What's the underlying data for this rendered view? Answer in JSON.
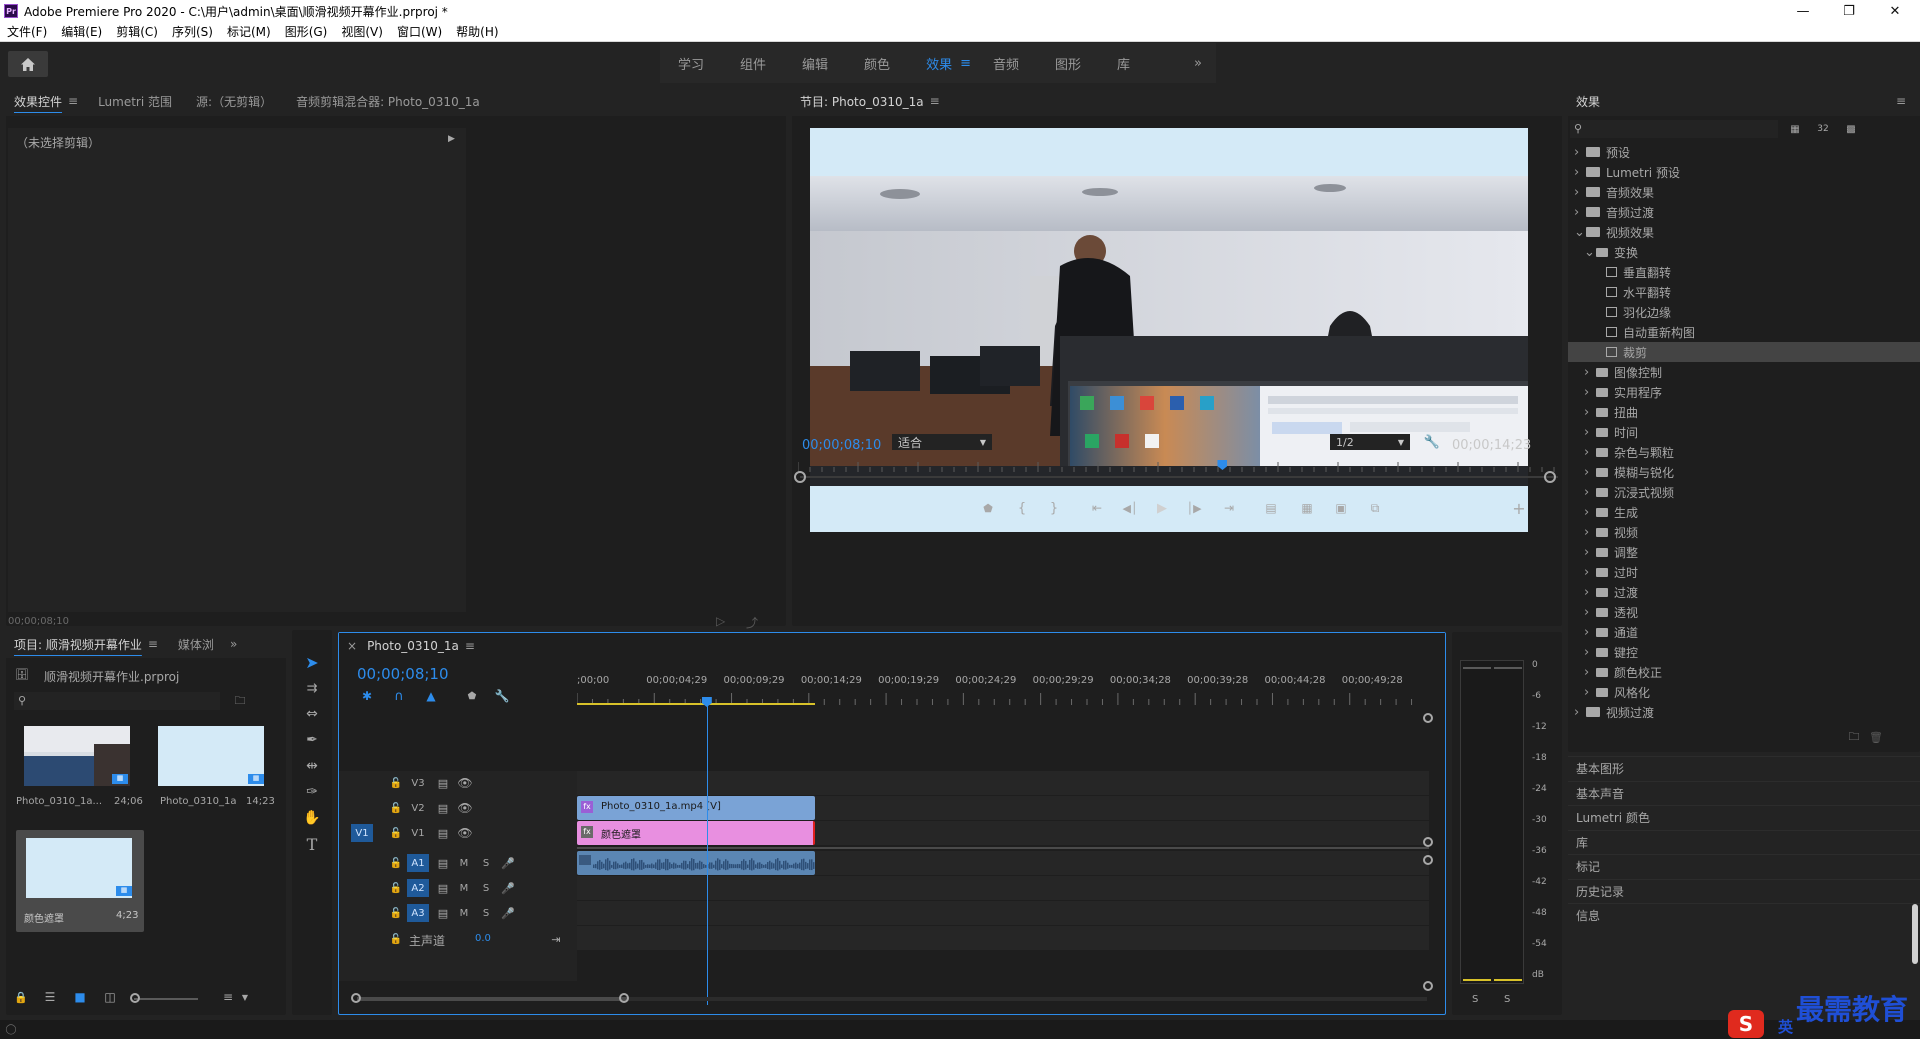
{
  "app": {
    "title": "Adobe Premiere Pro 2020 - C:\\用户\\admin\\桌面\\顺滑视频开幕作业.prproj *"
  },
  "menu": [
    "文件(F)",
    "编辑(E)",
    "剪辑(C)",
    "序列(S)",
    "标记(M)",
    "图形(G)",
    "视图(V)",
    "窗口(W)",
    "帮助(H)"
  ],
  "workspaces": [
    "学习",
    "组件",
    "编辑",
    "颜色",
    "效果",
    "音频",
    "图形",
    "库"
  ],
  "workspace_active": "效果",
  "effect_controls": {
    "tabs": [
      "效果控件",
      "Lumetri 范围",
      "源:（无剪辑）",
      "音频剪辑混合器: Photo_0310_1a"
    ],
    "no_clip": "（未选择剪辑）",
    "timecode": "00;00;08;10"
  },
  "program": {
    "title": "节目: Photo_0310_1a",
    "timecode": "00;00;08;10",
    "fit": "适合",
    "resolution": "1/2",
    "duration": "00;00;14;23",
    "playhead_fraction": 0.56
  },
  "project": {
    "tabs": [
      "项目: 顺滑视频开幕作业",
      "媒体浏"
    ],
    "file": "顺滑视频开幕作业.prproj",
    "items": [
      {
        "name": "Photo_0310_1a...",
        "duration": "24;06"
      },
      {
        "name": "Photo_0310_1a",
        "duration": "14;23"
      },
      {
        "name": "颜色遮罩",
        "duration": "4;23"
      }
    ]
  },
  "timeline": {
    "tab": "Photo_0310_1a",
    "timecode": "00;00;08;10",
    "ruler": [
      ";00;00",
      "00;00;04;29",
      "00;00;09;29",
      "00;00;14;29",
      "00;00;19;29",
      "00;00;24;29",
      "00;00;29;29",
      "00;00;34;28",
      "00;00;39;28",
      "00;00;44;28",
      "00;00;49;28"
    ],
    "video_tracks": [
      "V3",
      "V2",
      "V1"
    ],
    "audio_tracks": [
      "A1",
      "A2",
      "A3"
    ],
    "source_v": "V1",
    "master_label": "主声道",
    "master_value": "0.0",
    "clip_video": "Photo_0310_1a.mp4 [V]",
    "clip_matte": "颜色遮罩",
    "mute": "M",
    "solo": "S"
  },
  "meter": {
    "scale": [
      "0",
      "-6",
      "-12",
      "-18",
      "-24",
      "-30",
      "-36",
      "-42",
      "-48",
      "-54",
      "dB"
    ],
    "solo": [
      "S",
      "S"
    ]
  },
  "effects": {
    "title": "效果",
    "tree": [
      {
        "label": "预设",
        "level": 0,
        "type": "preset-folder",
        "open": false
      },
      {
        "label": "Lumetri 预设",
        "level": 0,
        "type": "preset-folder",
        "open": false
      },
      {
        "label": "音频效果",
        "level": 0,
        "type": "folder",
        "open": false
      },
      {
        "label": "音频过渡",
        "level": 0,
        "type": "folder",
        "open": false
      },
      {
        "label": "视频效果",
        "level": 0,
        "type": "folder",
        "open": true
      },
      {
        "label": "变换",
        "level": 1,
        "type": "folder",
        "open": true
      },
      {
        "label": "垂直翻转",
        "level": 2,
        "type": "effect"
      },
      {
        "label": "水平翻转",
        "level": 2,
        "type": "effect"
      },
      {
        "label": "羽化边缘",
        "level": 2,
        "type": "effect"
      },
      {
        "label": "自动重新构图",
        "level": 2,
        "type": "effect"
      },
      {
        "label": "裁剪",
        "level": 2,
        "type": "effect",
        "selected": true
      },
      {
        "label": "图像控制",
        "level": 1,
        "type": "folder",
        "open": false
      },
      {
        "label": "实用程序",
        "level": 1,
        "type": "folder",
        "open": false
      },
      {
        "label": "扭曲",
        "level": 1,
        "type": "folder",
        "open": false
      },
      {
        "label": "时间",
        "level": 1,
        "type": "folder",
        "open": false
      },
      {
        "label": "杂色与颗粒",
        "level": 1,
        "type": "folder",
        "open": false
      },
      {
        "label": "模糊与锐化",
        "level": 1,
        "type": "folder",
        "open": false
      },
      {
        "label": "沉浸式视频",
        "level": 1,
        "type": "folder",
        "open": false
      },
      {
        "label": "生成",
        "level": 1,
        "type": "folder",
        "open": false
      },
      {
        "label": "视频",
        "level": 1,
        "type": "folder",
        "open": false
      },
      {
        "label": "调整",
        "level": 1,
        "type": "folder",
        "open": false
      },
      {
        "label": "过时",
        "level": 1,
        "type": "folder",
        "open": false
      },
      {
        "label": "过渡",
        "level": 1,
        "type": "folder",
        "open": false
      },
      {
        "label": "透视",
        "level": 1,
        "type": "folder",
        "open": false
      },
      {
        "label": "通道",
        "level": 1,
        "type": "folder",
        "open": false
      },
      {
        "label": "键控",
        "level": 1,
        "type": "folder",
        "open": false
      },
      {
        "label": "颜色校正",
        "level": 1,
        "type": "folder",
        "open": false
      },
      {
        "label": "风格化",
        "level": 1,
        "type": "folder",
        "open": false
      },
      {
        "label": "视频过渡",
        "level": 0,
        "type": "folder",
        "open": false
      }
    ]
  },
  "side_panels": [
    "基本图形",
    "基本声音",
    "Lumetri 颜色",
    "库",
    "标记",
    "历史记录",
    "信息"
  ],
  "watermark": "最需教育",
  "ime": "英",
  "colors": {
    "accent": "#2d8ceb",
    "clip_video": "#7aa3d6",
    "clip_matte": "#e88fe0",
    "clip_audio": "#5b86b3",
    "frame_bg": "#d4eaf7"
  }
}
